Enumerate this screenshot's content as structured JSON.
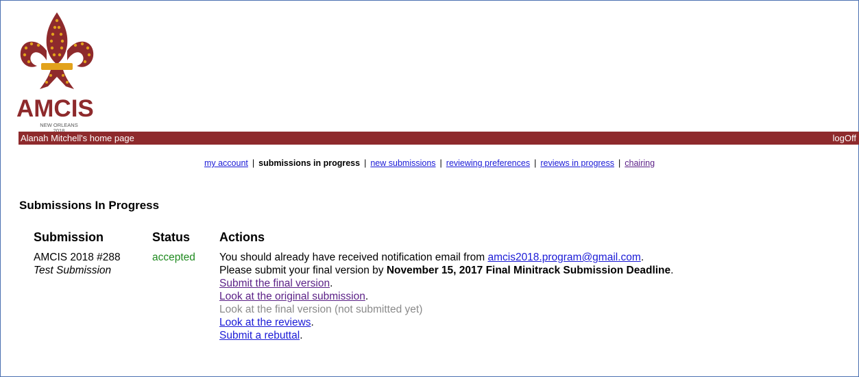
{
  "logo": {
    "name": "AMCIS",
    "subtitle_line1": "NEW ORLEANS",
    "subtitle_line2": "2018",
    "colors": {
      "maroon": "#8e2a2c",
      "gold": "#e2a21c"
    }
  },
  "header_bar": {
    "home_title": "Alanah Mitchell's home page",
    "logoff_label": "logOff"
  },
  "nav": {
    "my_account": "my account",
    "submissions_in_progress": "submissions in progress",
    "new_submissions": "new submissions",
    "reviewing_preferences": "reviewing preferences",
    "reviews_in_progress": "reviews in progress",
    "chairing": "chairing",
    "separator": "|"
  },
  "section_title": "Submissions In Progress",
  "table": {
    "headers": {
      "submission": "Submission",
      "status": "Status",
      "actions": "Actions"
    },
    "rows": [
      {
        "submission_id": "AMCIS 2018 #288",
        "submission_title": "Test Submission",
        "status": "accepted",
        "notice_prefix": "You should already have received notification email from ",
        "email": "amcis2018.program@gmail.com",
        "notice_suffix": ".",
        "deadline_prefix": "Please submit your final version by ",
        "deadline_bold": "November 15, 2017 Final Minitrack Submission Deadline",
        "deadline_suffix": ".",
        "submit_final": "Submit the final version",
        "look_original": "Look at the original submission",
        "look_final_disabled": "Look at the final version (not submitted yet)",
        "look_reviews": "Look at the reviews",
        "submit_rebuttal": "Submit a rebuttal",
        "period": "."
      }
    ]
  },
  "colors": {
    "frame_border": "#4a6fb0",
    "header_bar": "#8e2a2c",
    "link": "#1a1ad6",
    "visited_link": "#5a1f86",
    "status_accepted": "#1f8a1f",
    "disabled_text": "#8a8a8a"
  }
}
